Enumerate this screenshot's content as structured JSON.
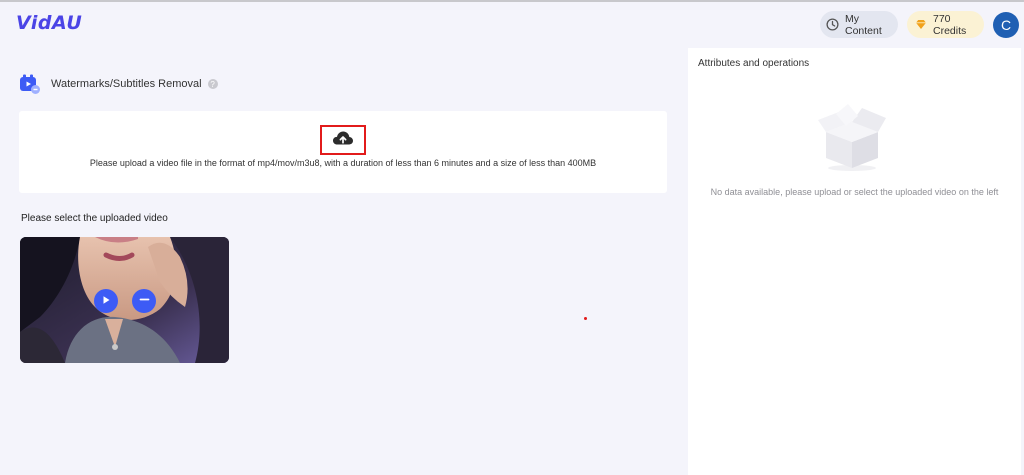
{
  "header": {
    "logo": "VidAU",
    "my_content_label": "My Content",
    "credits_label": "770 Credits",
    "avatar_initial": "C"
  },
  "tool": {
    "title": "Watermarks/Subtitles Removal",
    "help_symbol": "?"
  },
  "upload": {
    "instructions": "Please upload a video file in the format of mp4/mov/m3u8, with a duration of less than 6 minutes and a size of less than 400MB",
    "icon": "cloud-upload-icon"
  },
  "uploaded_videos": {
    "label": "Please select the uploaded video",
    "items": [
      {
        "thumbnail": "woman-portrait",
        "play_icon": "play-icon",
        "remove_icon": "minus-icon"
      }
    ]
  },
  "attributes_panel": {
    "title": "Attributes and operations",
    "empty_message": "No data available, please upload or select the uploaded video on the left",
    "illustration": "empty-box-icon"
  },
  "colors": {
    "brand": "#4b44e6",
    "accent_blue": "#3d5bf5",
    "highlight_red": "#e21b1b",
    "background": "#f4f4fb"
  }
}
